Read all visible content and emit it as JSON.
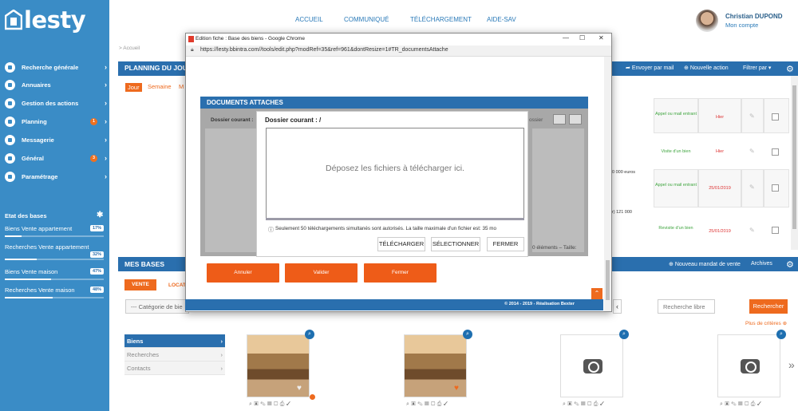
{
  "brand": {
    "name": "lesty"
  },
  "sidebar": {
    "items": [
      {
        "label": "Recherche générale",
        "badge": ""
      },
      {
        "label": "Annuaires",
        "badge": ""
      },
      {
        "label": "Gestion des actions",
        "badge": ""
      },
      {
        "label": "Planning",
        "badge": "1"
      },
      {
        "label": "Messagerie",
        "badge": ""
      },
      {
        "label": "Général",
        "badge": "3"
      },
      {
        "label": "Paramétrage",
        "badge": ""
      }
    ],
    "etat_title": "Etat des bases",
    "bases": [
      {
        "label": "Biens Vente appartement",
        "pct": "17%",
        "value": 0.17
      },
      {
        "label": "Recherches Vente appartement",
        "pct": "32%",
        "value": 0.32
      },
      {
        "label": "Biens Vente maison",
        "pct": "47%",
        "value": 0.47
      },
      {
        "label": "Recherches Vente maison",
        "pct": "48%",
        "value": 0.48
      }
    ]
  },
  "header": {
    "nav": [
      "ACCUEIL",
      "COMMUNIQUÉ",
      "TÉLÉCHARGEMENT",
      "AIDE-SAV"
    ],
    "user_name": "Christian DUPOND",
    "user_account": "Mon compte"
  },
  "breadcrumb": "> Accueil",
  "planning": {
    "title": "PLANNING DU JOU",
    "actions": [
      "Envoyer par mail",
      "Nouvelle action",
      "Filtrer par"
    ],
    "tabs": [
      "Jour",
      "Semaine",
      "M"
    ],
    "rows": [
      {
        "type": "Appel ou mail entrant",
        "date": "Hier",
        "note": ""
      },
      {
        "type": "Visite d'un bien",
        "date": "Hier",
        "note": ""
      },
      {
        "type": "Appel ou mail entrant",
        "date": "25/01/2019",
        "note": "0 000 euros"
      },
      {
        "type": "Revisite d'un bien",
        "date": "25/01/2019",
        "note": "(er) 121 000"
      }
    ]
  },
  "bases": {
    "title": "MES BASES",
    "actions": [
      "Nouveau mandat de vente",
      "Archives"
    ],
    "tab_vente": "VENTE",
    "tab_location": "LOCATI",
    "category_placeholder": "--- Catégorie de bie",
    "search_placeholder": "Recherche libre",
    "search_button": "Rechercher",
    "more_criteria": "Plus de critères",
    "menu": [
      "Biens",
      "Recherches",
      "Contacts"
    ]
  },
  "popup": {
    "window_title": "Edition fiche : Base des biens - Google Chrome",
    "url": "https://lesty.bbintra.com//tools/edit.php?modRef=35&ref=961&dontResize=1#TR_documentsAttache",
    "docs_title": "DOCUMENTS ATTACHES",
    "dossier_bg": "Dossier courant :",
    "dossier_right": "ossier",
    "elements_label": "0 éléments – Taille:",
    "dialog_title": "Dossier courant : /",
    "drop_text": "Déposez les fichiers à télécharger ici.",
    "info_text": "Seulement 50 téléchargements simultanés sont autorisés. La taille maximale d'un fichier est: 35 mo",
    "buttons": [
      "TÉLÉCHARGER",
      "SÉLECTIONNER",
      "FERMER"
    ],
    "form_buttons": [
      "Annuler",
      "Valider",
      "Fermer"
    ],
    "footer": "© 2014 - 2019 - Réalisation Bexter"
  },
  "colors": {
    "primary": "#2a6fae",
    "accent": "#ee6a1e",
    "sidebar": "#3a8cc6"
  }
}
